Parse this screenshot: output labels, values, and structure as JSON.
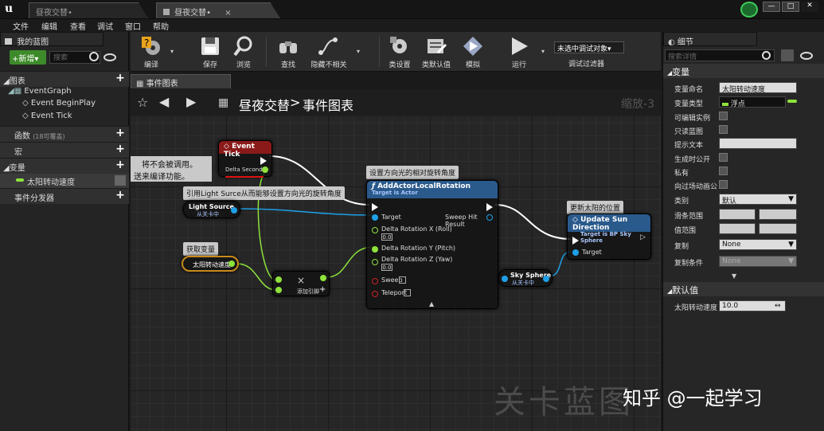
{
  "titlebar": {
    "logo": "u",
    "tabs": [
      {
        "label": "昼夜交替•"
      },
      {
        "label": "昼夜交替•"
      }
    ],
    "window_buttons": [
      "—",
      "□",
      "✕"
    ]
  },
  "menu": [
    "文件",
    "编辑",
    "查看",
    "调试",
    "窗口",
    "帮助"
  ],
  "left_panel": {
    "header": "我的蓝图",
    "new_button": "+新增▾",
    "search_placeholder": "搜索",
    "sections": {
      "graphs": "图表",
      "event_graph": "EventGraph",
      "event_begin": "Event BeginPlay",
      "event_tick": "Event Tick",
      "functions": "函数",
      "functions_note": "(18可覆盖)",
      "macros": "宏",
      "variables": "变量",
      "variable_item": "太阳转动速度",
      "dispatchers": "事件分发器"
    }
  },
  "toolbar": {
    "buttons": [
      {
        "label": "编译"
      },
      {
        "label": "保存"
      },
      {
        "label": "浏览"
      },
      {
        "label": "查找"
      },
      {
        "label": "隐藏不相关"
      },
      {
        "label": "类设置"
      },
      {
        "label": "类默认值"
      },
      {
        "label": "模拟"
      },
      {
        "label": "运行"
      }
    ],
    "debug_select": "未选中调试对象▾",
    "debug_filter": "调试过滤器"
  },
  "graph": {
    "tab": "事件图表",
    "breadcrumb_root": "昼夜交替",
    "breadcrumb_sep": ">",
    "breadcrumb_leaf": "事件图表",
    "zoom": "缩放-3",
    "watermark": "关卡蓝图",
    "warning_lines": [
      "将不会被调用。",
      "送来编译功能。"
    ],
    "comments": {
      "rotate": "设置方向光的相对旋转角度",
      "ref_light": "引用Light Surce从而能够设置方向光的旋转角度",
      "get_var": "获取变量",
      "update_sun": "更新太阳的位置"
    },
    "nodes": {
      "event_tick": {
        "title": "Event Tick",
        "pin": "Delta Seconds"
      },
      "light_source": {
        "title": "Light Source",
        "sub": "从关卡中"
      },
      "sun_speed": {
        "title": "太阳转动速度"
      },
      "multiply": {
        "symbol": "×",
        "add_pin": "添加引脚"
      },
      "add_rotation": {
        "title": "AddActorLocalRotation",
        "sub": "Target is Actor",
        "target": "Target",
        "sweep_hit": "Sweep Hit Result",
        "roll": "Delta Rotation X (Roll)",
        "pitch": "Delta Rotation Y (Pitch)",
        "yaw": "Delta Rotation Z (Yaw)",
        "roll_val": "0.0",
        "yaw_val": "0.0",
        "sweep": "Sweep",
        "teleport": "Teleport"
      },
      "sky_sphere": {
        "title": "Sky Sphere",
        "sub": "从关卡中"
      },
      "update_sun": {
        "title": "Update Sun Direction",
        "sub": "Target is BP Sky Sphere",
        "target": "Target"
      }
    }
  },
  "details": {
    "header": "细节",
    "search_placeholder": "搜索详情",
    "variable_section": "变量",
    "rows": {
      "var_name_label": "变量命名",
      "var_name_value": "太阳转动速度",
      "var_type_label": "变量类型",
      "var_type_value": "浮点",
      "editable_label": "可编辑实例",
      "readonly_label": "只读蓝图",
      "tooltip_label": "提示文本",
      "spawn_label": "生成时公开",
      "private_label": "私有",
      "cinematic_label": "向过场动画公",
      "category_label": "类别",
      "category_value": "默认",
      "slider_label": "滑条范围",
      "value_label": "值范围",
      "replication_label": "复制",
      "replication_value": "None",
      "repcond_label": "复制条件",
      "repcond_value": "None"
    },
    "default_section": "默认值",
    "default_label": "太阳转动速度",
    "default_value": "10.0"
  },
  "overlay_watermark": "知乎 @一起学习",
  "colors": {
    "event_header": "#8a1a1a",
    "function_header": "#2a5a8c",
    "float_pin": "#8ee33c",
    "object_pin": "#1ea0e8",
    "exec_pin": "#ffffff"
  }
}
